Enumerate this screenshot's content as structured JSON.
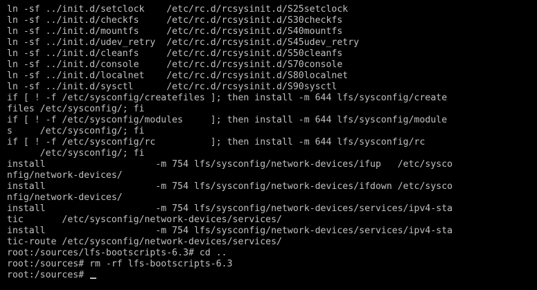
{
  "terminal": {
    "lines": [
      "ln -sf ../init.d/setclock    /etc/rc.d/rcsysinit.d/S25setclock",
      "ln -sf ../init.d/checkfs     /etc/rc.d/rcsysinit.d/S30checkfs",
      "ln -sf ../init.d/mountfs     /etc/rc.d/rcsysinit.d/S40mountfs",
      "ln -sf ../init.d/udev_retry  /etc/rc.d/rcsysinit.d/S45udev_retry",
      "ln -sf ../init.d/cleanfs     /etc/rc.d/rcsysinit.d/S50cleanfs",
      "ln -sf ../init.d/console     /etc/rc.d/rcsysinit.d/S70console",
      "ln -sf ../init.d/localnet    /etc/rc.d/rcsysinit.d/S80localnet",
      "ln -sf ../init.d/sysctl      /etc/rc.d/rcsysinit.d/S90sysctl",
      "if [ ! -f /etc/sysconfig/createfiles ]; then install -m 644 lfs/sysconfig/create",
      "files /etc/sysconfig/; fi",
      "if [ ! -f /etc/sysconfig/modules     ]; then install -m 644 lfs/sysconfig/module",
      "s     /etc/sysconfig/; fi",
      "if [ ! -f /etc/sysconfig/rc          ]; then install -m 644 lfs/sysconfig/rc",
      "      /etc/sysconfig/; fi",
      "install                    -m 754 lfs/sysconfig/network-devices/ifup   /etc/sysco",
      "nfig/network-devices/",
      "install                    -m 754 lfs/sysconfig/network-devices/ifdown /etc/sysco",
      "nfig/network-devices/",
      "install                    -m 754 lfs/sysconfig/network-devices/services/ipv4-sta",
      "tic       /etc/sysconfig/network-devices/services/",
      "install                    -m 754 lfs/sysconfig/network-devices/services/ipv4-sta",
      "tic-route /etc/sysconfig/network-devices/services/",
      "root:/sources/lfs-bootscripts-6.3# cd ..",
      "root:/sources# rm -rf lfs-bootscripts-6.3"
    ],
    "prompt": "root:/sources# ",
    "colors": {
      "background": "#000000",
      "foreground": "#c0c0c0"
    }
  }
}
